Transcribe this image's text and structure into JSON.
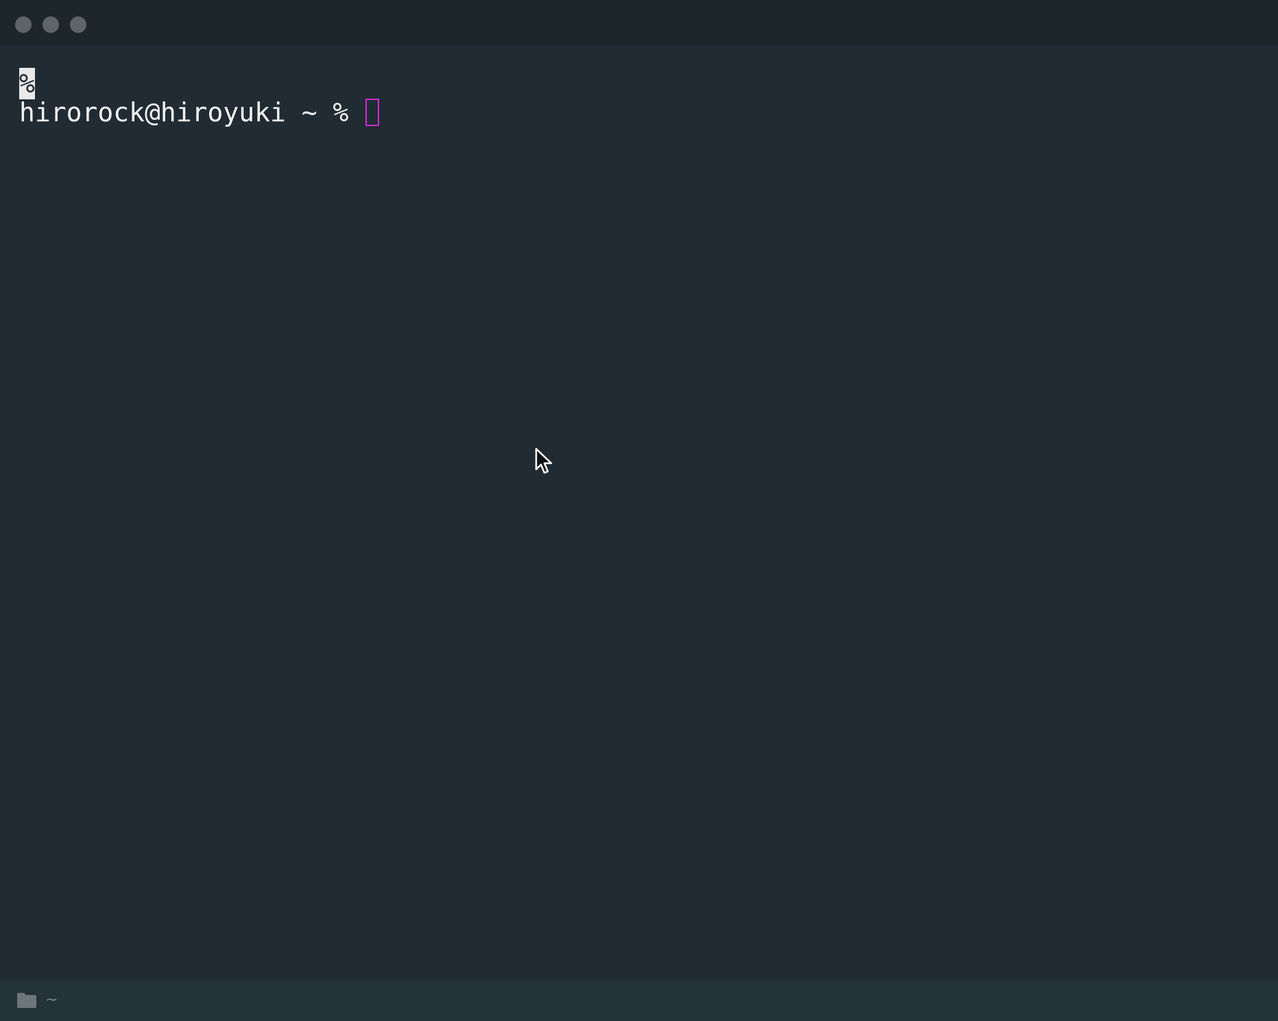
{
  "window": {
    "traffic_lights": [
      "close",
      "minimize",
      "zoom"
    ]
  },
  "terminal": {
    "line1_marker": "%",
    "prompt": "hirorock@hiroyuki ~ % ",
    "cursor_color": "#d02bd0"
  },
  "statusbar": {
    "icon": "folder-icon",
    "path": "~"
  }
}
